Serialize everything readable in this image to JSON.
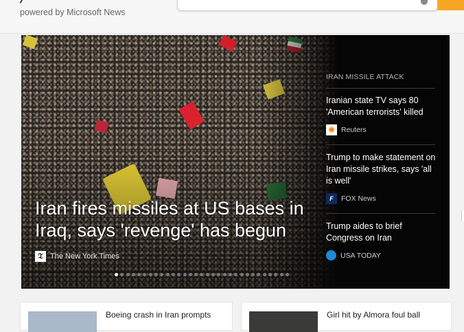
{
  "header": {
    "powered_by": "powered by Microsoft News",
    "search": {
      "value": "",
      "placeholder": ""
    }
  },
  "hero": {
    "title": "Iran fires missiles at US bases in Iraq, says 'revenge' has begun",
    "source": "The New York Times",
    "carousel": {
      "count": 31,
      "active_index": 0
    }
  },
  "side": {
    "category": "IRAN MISSILE ATTACK",
    "items": [
      {
        "headline": "Iranian state TV says 80 'American terrorists' killed",
        "source": "Reuters",
        "icon": "reuters-icon"
      },
      {
        "headline": "Trump to make statement on Iran missile strikes, says 'all is well'",
        "source": "FOX News",
        "icon": "fox-news-icon"
      },
      {
        "headline": "Trump aides to brief Congress on Iran",
        "source": "USA TODAY",
        "icon": "usa-today-icon"
      }
    ]
  },
  "cards": [
    {
      "title": "Boeing crash in Iran prompts"
    },
    {
      "title": "Girl hit by Almora foul ball"
    }
  ],
  "colors": {
    "search_button": "#f6a623",
    "hero_background": "#16161a",
    "page_background": "#f2f2f2"
  }
}
